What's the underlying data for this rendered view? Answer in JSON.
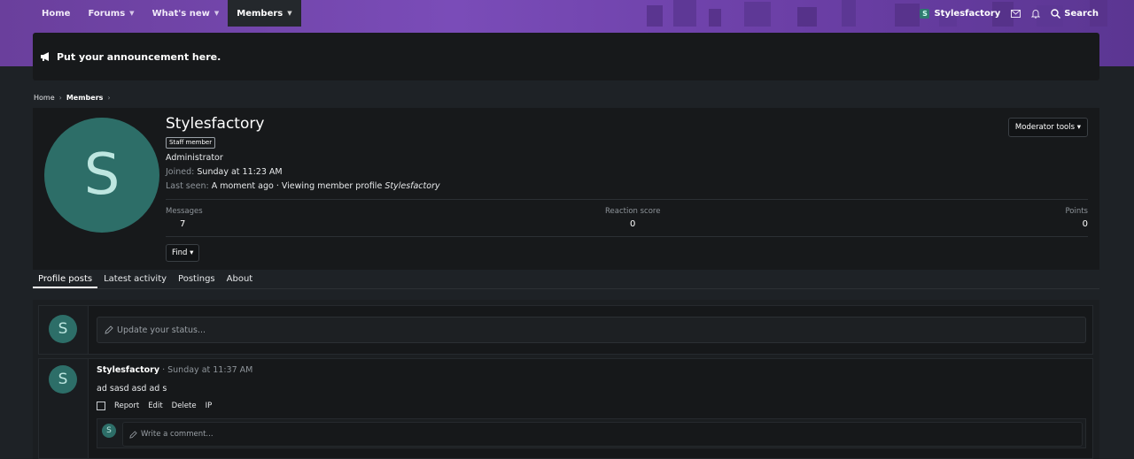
{
  "nav": {
    "items": [
      {
        "label": "Home"
      },
      {
        "label": "Forums",
        "caret": "▼"
      },
      {
        "label": "What's new",
        "caret": "▼"
      },
      {
        "label": "Members",
        "caret": "▼"
      }
    ],
    "user": "Stylesfactory",
    "user_initial": "S",
    "search_label": "Search"
  },
  "announcement": "Put your announcement here.",
  "breadcrumb": {
    "home": "Home",
    "current": "Members"
  },
  "profile": {
    "name": "Stylesfactory",
    "initial": "S",
    "badge": "Staff member",
    "title": "Administrator",
    "joined_label": "Joined:",
    "joined_value": "Sunday at 11:23 AM",
    "last_seen_label": "Last seen:",
    "last_seen_value": "A moment ago · Viewing member profile",
    "last_seen_target": "Stylesfactory",
    "moderator_tools": "Moderator tools ▾",
    "find": "Find ▾",
    "stats": [
      {
        "label": "Messages",
        "value": "7"
      },
      {
        "label": "Reaction score",
        "value": "0"
      },
      {
        "label": "Points",
        "value": "0"
      }
    ]
  },
  "tabs": [
    "Profile posts",
    "Latest activity",
    "Postings",
    "About"
  ],
  "status_placeholder": "Update your status...",
  "post": {
    "author": "Stylesfactory",
    "time": "· Sunday at 11:37 AM",
    "body": "ad sasd asd ad s",
    "actions": [
      "Report",
      "Edit",
      "Delete",
      "IP"
    ],
    "comment_placeholder": "Write a comment..."
  },
  "colors": {
    "accent": "#7a4cb8",
    "avatar": "#2d6e68",
    "panel": "#17191b"
  }
}
